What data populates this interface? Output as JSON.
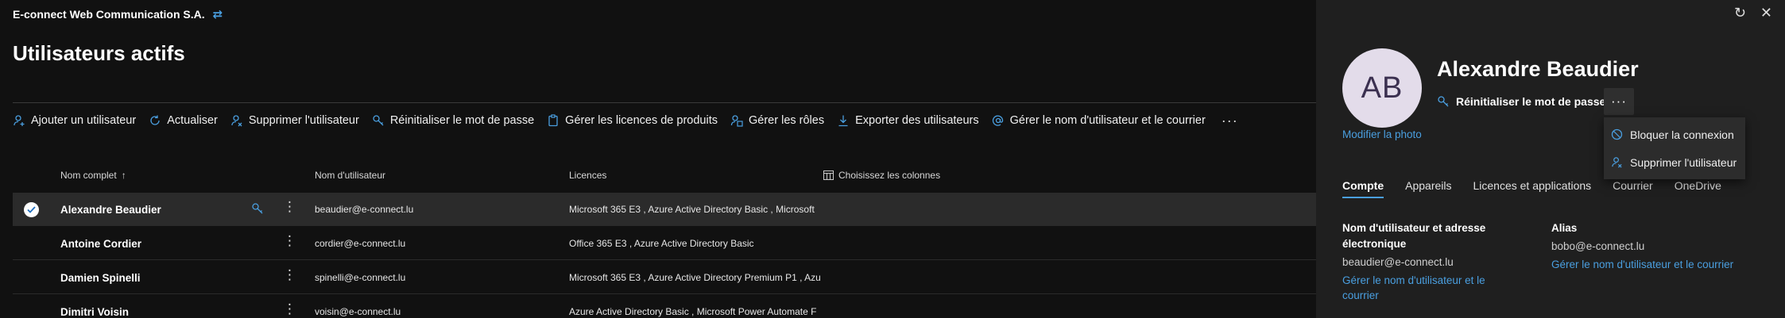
{
  "header": {
    "org_name": "E-connect Web Communication S.A.",
    "page_title": "Utilisateurs actifs"
  },
  "toolbar": {
    "add_user": "Ajouter un utilisateur",
    "refresh": "Actualiser",
    "delete_user": "Supprimer l'utilisateur",
    "reset_password": "Réinitialiser le mot de passe",
    "manage_licenses": "Gérer les licences de produits",
    "manage_roles": "Gérer les rôles",
    "export_users": "Exporter des utilisateurs",
    "manage_username": "Gérer le nom d'utilisateur et le courrier",
    "more": "···"
  },
  "table": {
    "columns": {
      "name": "Nom complet",
      "name_sort": "↑",
      "username": "Nom d'utilisateur",
      "licenses": "Licences",
      "choose_columns": "Choisissez les colonnes"
    },
    "rows": [
      {
        "name": "Alexandre Beaudier",
        "username": "beaudier@e-connect.lu",
        "licenses": "Microsoft 365 E3 , Azure Active Directory Basic , Microsoft",
        "selected": true
      },
      {
        "name": "Antoine Cordier",
        "username": "cordier@e-connect.lu",
        "licenses": "Office 365 E3 , Azure Active Directory Basic",
        "selected": false
      },
      {
        "name": "Damien Spinelli",
        "username": "spinelli@e-connect.lu",
        "licenses": "Microsoft 365 E3 , Azure Active Directory Premium P1 , Azu",
        "selected": false
      },
      {
        "name": "Dimitri Voisin",
        "username": "voisin@e-connect.lu",
        "licenses": "Azure Active Directory Basic , Microsoft Power Automate F",
        "selected": false
      }
    ]
  },
  "panel": {
    "initials": "AB",
    "user_name": "Alexandre Beaudier",
    "modify_photo": "Modifier la photo",
    "reset_password": "Réinitialiser le mot de passe",
    "more": "···",
    "menu": {
      "block_signin": "Bloquer la connexion",
      "delete_user": "Supprimer l'utilisateur"
    },
    "tabs": [
      "Compte",
      "Appareils",
      "Licences et applications",
      "Courrier",
      "OneDrive"
    ],
    "account": {
      "username_label": "Nom d'utilisateur et adresse électronique",
      "username_value": "beaudier@e-connect.lu",
      "username_link": "Gérer le nom d'utilisateur et le courrier",
      "alias_label": "Alias",
      "alias_value": "bobo@e-connect.lu",
      "alias_link": "Gérer le nom d'utilisateur et le courrier"
    }
  },
  "colors": {
    "accent": "#4a9fe0",
    "background": "#111111",
    "panel_background": "#1f1f1f",
    "avatar_background": "#e3dcea"
  }
}
